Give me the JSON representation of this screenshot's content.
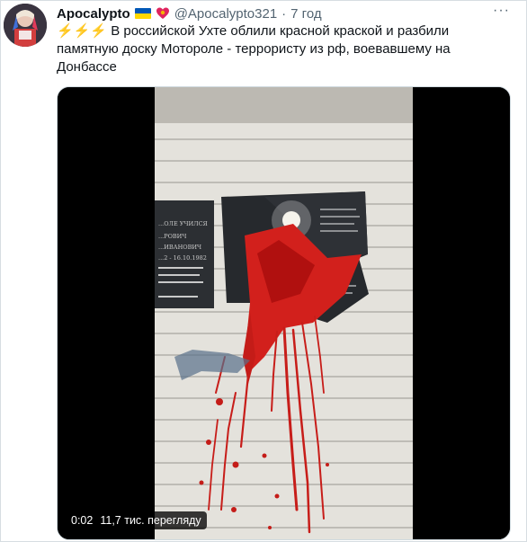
{
  "author": {
    "name": "Apocalypto",
    "handle": "@Apocalypto321",
    "separator": "·",
    "time": "7 год"
  },
  "icons": {
    "flag": "ukraine-flag-icon",
    "heart": "heart-icon",
    "more": "more-icon",
    "bolt": "lightning-icon"
  },
  "tweet": {
    "emoji": "⚡⚡⚡",
    "text": " В российской Ухте облили красной краской и разбили памятную доску Моторолe - террористу из рф, воевавшему на Донбассе"
  },
  "video": {
    "duration": "0:02",
    "views": "11,7 тис. перегляду",
    "plaque_lines": [
      "...ОЛЕ УЧИЛСЯ",
      "...РОВИЧ",
      "...ИВАНОВИЧ",
      "...2 - 16.10.1982"
    ]
  },
  "colors": {
    "accent": "#1d9bf0",
    "paint": "#d2201c",
    "wall": "#e4e2dc"
  }
}
